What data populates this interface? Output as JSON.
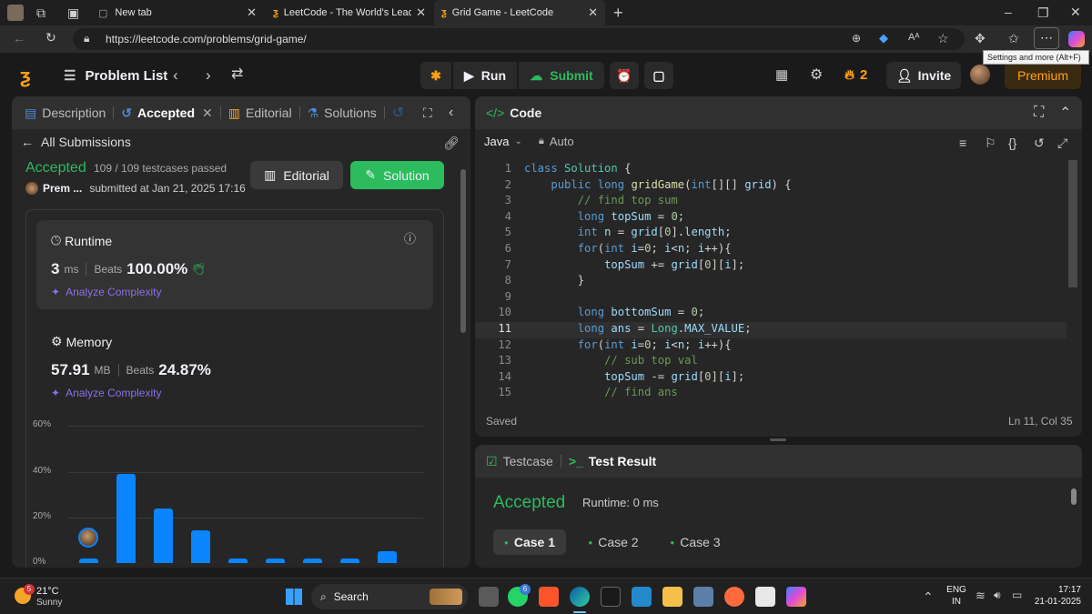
{
  "browser": {
    "tabs": [
      {
        "title": "New tab",
        "active": false
      },
      {
        "title": "LeetCode - The World's Leading C",
        "active": false
      },
      {
        "title": "Grid Game - LeetCode",
        "active": true
      }
    ],
    "url": "https://leetcode.com/problems/grid-game/",
    "tooltip": "Settings and more (Alt+F)"
  },
  "nav": {
    "problem_list": "Problem List",
    "run": "Run",
    "submit": "Submit",
    "streak": "2",
    "invite": "Invite",
    "premium": "Premium"
  },
  "left": {
    "tabs": {
      "description": "Description",
      "accepted": "Accepted",
      "editorial": "Editorial",
      "solutions": "Solutions"
    },
    "all_submissions": "All Submissions",
    "status": "Accepted",
    "testcases": "109 / 109 testcases passed",
    "user": "Prem ...",
    "submitted_at": "submitted at Jan 21, 2025 17:16",
    "editorial_btn": "Editorial",
    "solution_btn": "Solution",
    "runtime": {
      "title": "Runtime",
      "value": "3",
      "unit": "ms",
      "beats_label": "Beats",
      "beats": "100.00%",
      "analyze": "Analyze Complexity"
    },
    "memory": {
      "title": "Memory",
      "value": "57.91",
      "unit": "MB",
      "beats_label": "Beats",
      "beats": "24.87%",
      "analyze": "Analyze Complexity"
    }
  },
  "chart_data": {
    "type": "bar",
    "ytick_labels": [
      "60%",
      "40%",
      "20%",
      "0%"
    ],
    "ylim": [
      0,
      60
    ],
    "values": [
      2,
      39,
      24,
      14.5,
      2,
      2,
      2,
      2,
      5
    ],
    "highlight_index": 0,
    "color": "#0a84ff"
  },
  "code": {
    "title": "Code",
    "language": "Java",
    "mode": "Auto",
    "status": "Saved",
    "position": "Ln 11, Col 35",
    "lines": [
      "class Solution {",
      "    public long gridGame(int[][] grid) {",
      "        // find top sum",
      "        long topSum = 0;",
      "        int n = grid[0].length;",
      "        for(int i=0; i<n; i++){",
      "            topSum += grid[0][i];",
      "        }",
      "",
      "        long bottomSum = 0;",
      "        long ans = Long.MAX_VALUE;",
      "        for(int i=0; i<n; i++){",
      "            // sub top val",
      "            topSum -= grid[0][i];",
      "            // find ans"
    ]
  },
  "result": {
    "tab_testcase": "Testcase",
    "tab_result": "Test Result",
    "status": "Accepted",
    "runtime": "Runtime: 0 ms",
    "cases": [
      "Case 1",
      "Case 2",
      "Case 3"
    ]
  },
  "taskbar": {
    "weather_temp": "21°C",
    "weather_desc": "Sunny",
    "weather_badge": "5",
    "search": "Search",
    "whatsapp_badge": "6",
    "lang": "ENG",
    "region": "IN",
    "time": "17:17",
    "date": "21-01-2025"
  },
  "colors": {
    "green": "#2cbb5d",
    "accent_blue": "#0a84ff",
    "orange": "#ffa116"
  }
}
